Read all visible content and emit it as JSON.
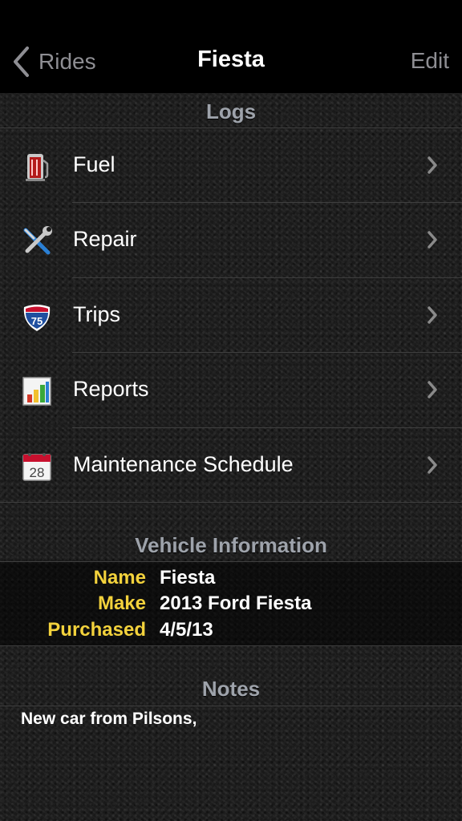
{
  "navbar": {
    "back_label": "Rides",
    "title": "Fiesta",
    "edit_label": "Edit"
  },
  "logs_header": "Logs",
  "logs": [
    {
      "label": "Fuel",
      "icon": "fuel-pump-icon"
    },
    {
      "label": "Repair",
      "icon": "wrench-screwdriver-icon"
    },
    {
      "label": "Trips",
      "icon": "interstate-75-sign-icon"
    },
    {
      "label": "Reports",
      "icon": "bar-chart-icon"
    },
    {
      "label": "Maintenance Schedule",
      "icon": "calendar-28-icon"
    }
  ],
  "vehicle_info": {
    "header": "Vehicle Information",
    "rows": [
      {
        "key": "Name",
        "value": "Fiesta"
      },
      {
        "key": "Make",
        "value": "2013 Ford Fiesta"
      },
      {
        "key": "Purchased",
        "value": "4/5/13"
      }
    ]
  },
  "notes": {
    "header": "Notes",
    "text": "New car from Pilsons,"
  },
  "colors": {
    "accent_label": "#f3d23c",
    "header_gray": "#9ea3ab",
    "nav_gray": "#8e8e93"
  }
}
